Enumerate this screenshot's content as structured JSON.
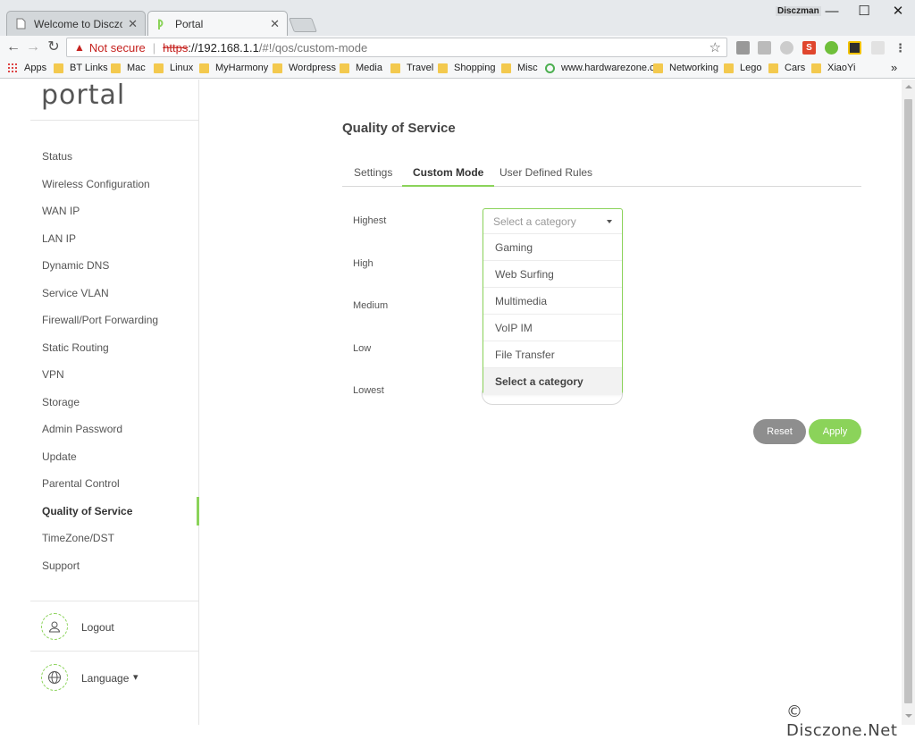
{
  "browser": {
    "tabs": [
      {
        "title": "Welcome to Disczone! - □",
        "close": "✕"
      },
      {
        "title": "Portal",
        "close": "✕"
      }
    ],
    "user_badge": "Disczman",
    "window_controls": {
      "minimize": "—",
      "maximize": "☐",
      "close": "✕"
    },
    "nav": {
      "back": "←",
      "forward": "→",
      "reload": "↻"
    },
    "address": {
      "warning_icon": "▲",
      "security_text": "Not secure",
      "separator": "|",
      "protocol": "https",
      "host": "://192.168.1.1",
      "path": "/#!/qos/custom-mode"
    },
    "star": "☆",
    "bookmarks": [
      {
        "label": "Apps",
        "icon": "apps-grid-icon"
      },
      {
        "label": "BT Links",
        "icon": "folder-icon"
      },
      {
        "label": "Mac",
        "icon": "folder-icon"
      },
      {
        "label": "Linux",
        "icon": "folder-icon"
      },
      {
        "label": "MyHarmony",
        "icon": "folder-icon"
      },
      {
        "label": "Wordpress",
        "icon": "folder-icon"
      },
      {
        "label": "Media",
        "icon": "folder-icon"
      },
      {
        "label": "Travel",
        "icon": "folder-icon"
      },
      {
        "label": "Shopping",
        "icon": "folder-icon"
      },
      {
        "label": "Misc",
        "icon": "folder-icon"
      },
      {
        "label": "www.hardwarezone.c",
        "icon": "globe-icon"
      },
      {
        "label": "Networking",
        "icon": "folder-icon"
      },
      {
        "label": "Lego",
        "icon": "folder-icon"
      },
      {
        "label": "Cars",
        "icon": "folder-icon"
      },
      {
        "label": "XiaoYi",
        "icon": "folder-icon"
      }
    ],
    "bookmarks_more": "»"
  },
  "portal": {
    "logo": "portal",
    "menu": [
      "Status",
      "Wireless Configuration",
      "WAN IP",
      "LAN IP",
      "Dynamic DNS",
      "Service VLAN",
      "Firewall/Port Forwarding",
      "Static Routing",
      "VPN",
      "Storage",
      "Admin Password",
      "Update",
      "Parental Control",
      "Quality of Service",
      "TimeZone/DST",
      "Support"
    ],
    "active_menu": "Quality of Service",
    "logout": "Logout",
    "language": "Language",
    "language_caret": "▾"
  },
  "content": {
    "title": "Quality of Service",
    "tabs": [
      "Settings",
      "Custom Mode",
      "User Defined Rules"
    ],
    "active_tab": "Custom Mode",
    "priorities": [
      "Highest",
      "High",
      "Medium",
      "Low",
      "Lowest"
    ],
    "dropdown": {
      "placeholder": "Select a category",
      "options": [
        "Gaming",
        "Web Surfing",
        "Multimedia",
        "VoIP IM",
        "File Transfer",
        "Select a category"
      ],
      "selected": "Select a category"
    },
    "buttons": {
      "reset": "Reset",
      "apply": "Apply"
    }
  },
  "watermark": "© Disczone.Net",
  "colors": {
    "accent": "#8bd35a",
    "reset_button": "#8e8e8e",
    "warning": "#c5221f"
  }
}
